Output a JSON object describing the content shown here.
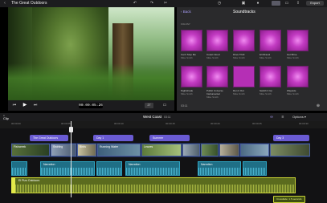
{
  "app": {
    "project_title": "The Great Outdoors",
    "export_label": "Export"
  },
  "viewer": {
    "timecode": "00:00:05:26",
    "zoom_value": "27"
  },
  "browser": {
    "back_label": "Back",
    "title": "Soundtracks",
    "section_label": "FOLKSY",
    "items": [
      {
        "title": "Can't Stop Me",
        "artist": "Mike Smith"
      },
      {
        "title": "Coast Cloud",
        "artist": "Mike Smith"
      },
      {
        "title": "Drive Thrill",
        "artist": "Mike Smith"
      },
      {
        "title": "El Mirasol",
        "artist": "Mike Smith"
      },
      {
        "title": "Gut Brixe",
        "artist": "Mike Smith"
      },
      {
        "title": "Nightshade",
        "artist": "Mike Smith"
      },
      {
        "title": "Public Universe Instrumental",
        "artist": "Mike Smith"
      },
      {
        "title": "Run It Out",
        "artist": "Mike Smith"
      },
      {
        "title": "Switch It Up",
        "artist": "Mike Smith"
      },
      {
        "title": "Wayside",
        "artist": "Mike Smith"
      }
    ],
    "duration": "03:11"
  },
  "timeline": {
    "clip_label": "Clip",
    "scope_prefix": "0",
    "project_name": "West Coast",
    "project_duration": "03:11",
    "options_label": "Options",
    "ruler_marks": [
      "00:00:00",
      "00:00:05",
      "00:00:10",
      "00:00:15",
      "00:00:20",
      "00:00:25",
      "00:00:30"
    ],
    "title_chips": [
      "The Great Outdoors",
      "Day 1",
      "Summer",
      "Day 3"
    ],
    "video_clips": [
      "Fishcreek",
      "Swirling",
      "Birds",
      "Running Water",
      "Leaves"
    ],
    "audio_clips": [
      "Narration",
      "Narration",
      "Narration"
    ],
    "music_clip": "El Pizo Outdoors",
    "music_badge": "Crossfade: 1.5 seconds"
  },
  "colors": {
    "accent": "#6a5bd3",
    "soundtrack": "#b52fb5",
    "audio": "#1f6f86",
    "music": "#5b6b1e"
  }
}
